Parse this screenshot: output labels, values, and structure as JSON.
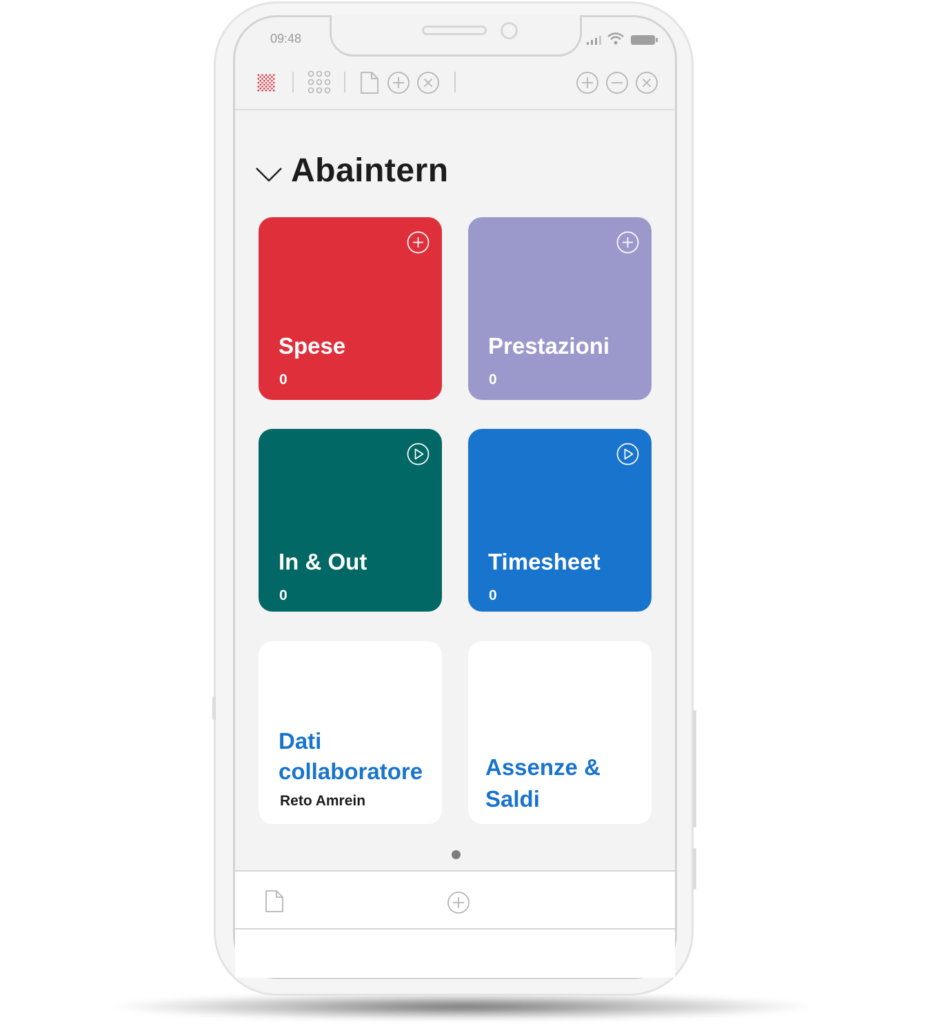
{
  "status_bar": {
    "time": "09:48"
  },
  "section": {
    "title": "Abaintern"
  },
  "tiles": [
    {
      "title": "Spese",
      "count": "0",
      "action_icon": "plus-circle-icon",
      "color": "#df2f3b"
    },
    {
      "title": "Prestazioni",
      "count": "0",
      "action_icon": "plus-circle-icon",
      "color": "#9b99cb"
    },
    {
      "title": "In & Out",
      "count": "0",
      "action_icon": "play-circle-icon",
      "color": "#026865"
    },
    {
      "title": "Timesheet",
      "count": "0",
      "action_icon": "play-circle-icon",
      "color": "#1874cc"
    },
    {
      "title_line1": "Dati",
      "title_line2": "collaboratore",
      "subtitle": "Reto Amrein",
      "color": "#ffffff",
      "text_color": "#1874cc"
    },
    {
      "title_line1": "Assenze &",
      "title_line2": "Saldi",
      "color": "#ffffff",
      "text_color": "#1874cc"
    }
  ],
  "colors": {
    "accent_red": "#df2f3b",
    "link_blue": "#1874cc",
    "frame_gray": "#d3d3d3"
  }
}
